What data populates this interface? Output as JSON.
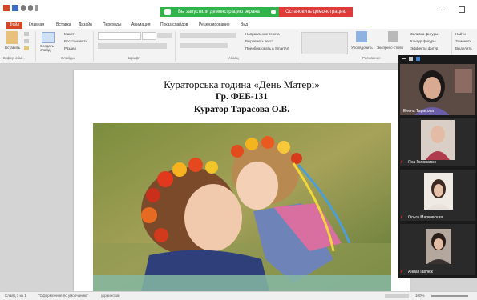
{
  "share_banner": {
    "text": "Вы запустили демонстрацию экрана",
    "stop_label": "Остановить демонстрацию"
  },
  "ribbon": {
    "tabs": [
      "Файл",
      "Главная",
      "Вставка",
      "Дизайн",
      "Переходы",
      "Анимация",
      "Показ слайдов",
      "Рецензирование",
      "Вид"
    ],
    "paste_label": "Вставить",
    "new_slide_label": "Создать слайд",
    "layout_label": "Макет",
    "restore_label": "Восстановить",
    "section_label": "Раздел",
    "text_direction_label": "Направление текста",
    "align_text_label": "Выровнять текст",
    "smartart_label": "Преобразовать в SmartArt",
    "arrange_label": "Упорядочить",
    "quick_styles_label": "Экспресс-стили",
    "shape_fill_label": "Заливка фигуры",
    "shape_outline_label": "Контур фигуры",
    "shape_effects_label": "Эффекты фигур",
    "find_label": "Найти",
    "replace_label": "Заменить",
    "select_label": "Выделить",
    "groups": {
      "clipboard": "Буфер обм...",
      "slides": "Слайды",
      "font": "Шрифт",
      "paragraph": "Абзац",
      "drawing": "Рисование"
    }
  },
  "slide": {
    "title": "Кураторська година «День Матері»",
    "group": "Гр. ФЕБ-131",
    "curator": "Куратор Тарасова О.В."
  },
  "participants": [
    {
      "name": "Елена Тарасова"
    },
    {
      "name": "Яна Головатюк"
    },
    {
      "name": "Ольга Марковская"
    },
    {
      "name": "Анна Павлюк"
    }
  ],
  "statusbar": {
    "slide_counter": "Слайд 1 из 1",
    "theme": "\"Оформление по умолчанию\"",
    "language": "украинский",
    "zoom": "100%"
  },
  "colors": {
    "share_green": "#2fb34a",
    "stop_red": "#e03b3b",
    "file_tab": "#d24726"
  }
}
